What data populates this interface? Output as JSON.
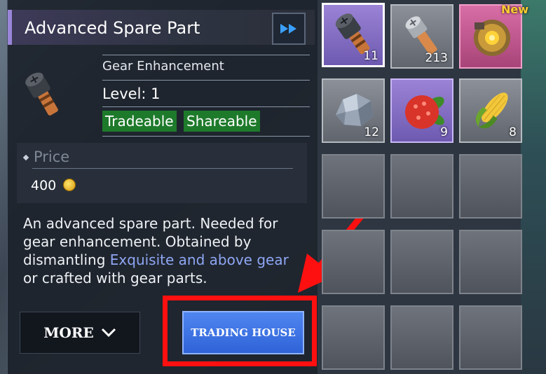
{
  "item": {
    "title": "Advanced Spare Part",
    "category": "Gear Enhancement",
    "level": "Level: 1",
    "tags": [
      "Tradeable",
      "Shareable"
    ],
    "price_label": "Price",
    "price_value": "400",
    "description_before": "An advanced spare part. Needed for gear enhancement. Obtained by dismantling ",
    "description_highlight": "Exquisite and above gear",
    "description_after": " or crafted with gear parts."
  },
  "buttons": {
    "more": "MORE",
    "trading_house": "TRADING HOUSE"
  },
  "inventory": {
    "new_badge": "New",
    "slots": [
      {
        "icon": "advanced-spare-part-icon",
        "count": "11",
        "rarity": "purple"
      },
      {
        "icon": "spare-part-icon",
        "count": "213",
        "rarity": "common"
      },
      {
        "icon": "golden-mechanism-icon",
        "count": "",
        "rarity": "pink"
      },
      {
        "icon": "ore-icon",
        "count": "12",
        "rarity": "common"
      },
      {
        "icon": "red-berry-icon",
        "count": "9",
        "rarity": "purple"
      },
      {
        "icon": "corn-icon",
        "count": "8",
        "rarity": "common"
      }
    ]
  },
  "colors": {
    "tag_green": "#1e7a2b",
    "highlight_blue": "#8fa6f4",
    "trade_button_blue": "#2f63d8",
    "annotation_red": "#ff1010"
  }
}
